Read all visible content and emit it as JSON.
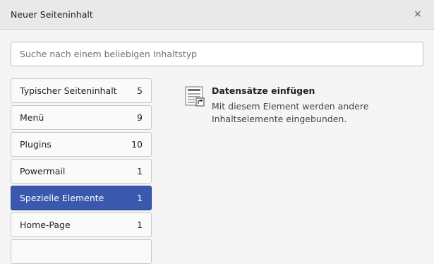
{
  "modal": {
    "title": "Neuer Seiteninhalt",
    "close_label": "×"
  },
  "search": {
    "placeholder": "Suche nach einem beliebigen Inhaltstyp"
  },
  "categories": [
    {
      "label": "Typischer Seiteninhalt",
      "count": "5",
      "active": false
    },
    {
      "label": "Menü",
      "count": "9",
      "active": false
    },
    {
      "label": "Plugins",
      "count": "10",
      "active": false
    },
    {
      "label": "Powermail",
      "count": "1",
      "active": false
    },
    {
      "label": "Spezielle Elemente",
      "count": "1",
      "active": true
    },
    {
      "label": "Home-Page",
      "count": "1",
      "active": false
    }
  ],
  "element": {
    "icon": "shortcut-records-icon",
    "name": "Datensätze einfügen",
    "description": "Mit diesem Element werden andere Inhaltselemente eingebunden."
  },
  "colors": {
    "accent": "#3a58ad",
    "header_bg": "#e9e9e9",
    "page_bg": "#f5f5f5"
  }
}
